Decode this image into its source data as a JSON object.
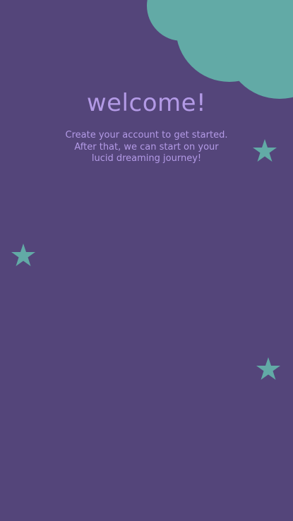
{
  "colors": {
    "background": "#54457a",
    "accent_teal": "#62aaa6",
    "text_lavender": "#b39ae6"
  },
  "decorations": {
    "cloud_icon": "cloud-icon",
    "moon_icon": "crescent-moon-icon",
    "star_icon": "star-icon"
  },
  "welcome": {
    "title": "welcome!",
    "subtitle_lines": [
      "Create your account to get started.",
      "After that, we can start on your",
      "lucid dreaming journey!"
    ]
  }
}
